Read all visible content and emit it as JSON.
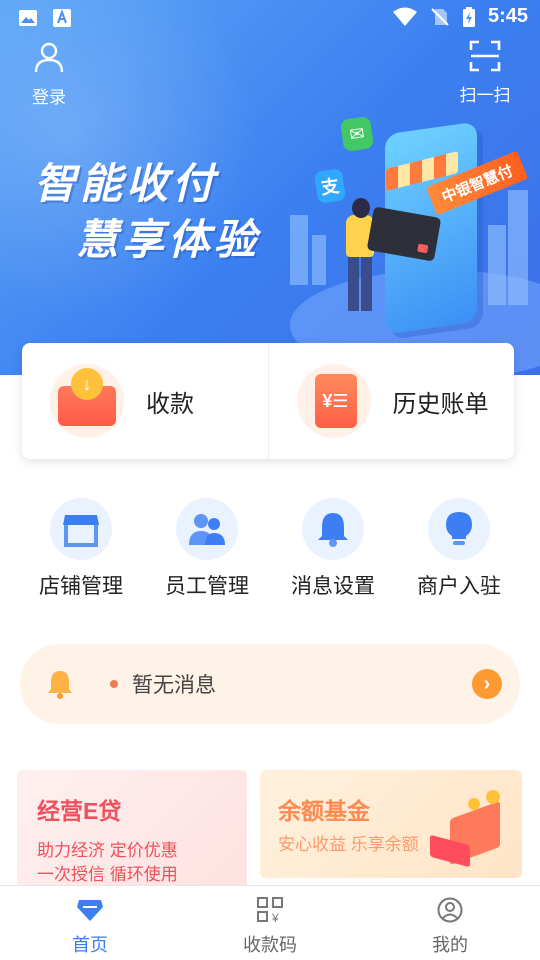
{
  "status_bar": {
    "time": "5:45"
  },
  "hero": {
    "login_label": "登录",
    "scan_label": "扫一扫",
    "slogan_line1": "智能收付",
    "slogan_line2": "慧享体验",
    "brand_tag": "中银智慧付"
  },
  "main_actions": [
    {
      "label": "收款",
      "icon": "envelope-coin-icon"
    },
    {
      "label": "历史账单",
      "icon": "bill-scroll-icon"
    }
  ],
  "grid": [
    {
      "label": "店铺管理",
      "icon": "store-icon"
    },
    {
      "label": "员工管理",
      "icon": "staff-icon"
    },
    {
      "label": "消息设置",
      "icon": "bell-icon"
    },
    {
      "label": "商户入驻",
      "icon": "bulb-icon"
    }
  ],
  "notice": {
    "text": "暂无消息"
  },
  "promos": {
    "loan": {
      "title": "经营E贷",
      "line1": "助力经济 定价优惠",
      "line2": "一次授信 循环使用"
    },
    "fund": {
      "title": "余额基金",
      "line1": "安心收益 乐享余额"
    }
  },
  "tabs": [
    {
      "label": "首页",
      "active": true
    },
    {
      "label": "收款码",
      "active": false
    },
    {
      "label": "我的",
      "active": false
    }
  ],
  "colors": {
    "primary": "#3b7ff0",
    "accent_orange": "#ff9a32",
    "loan_red": "#f0505b"
  }
}
